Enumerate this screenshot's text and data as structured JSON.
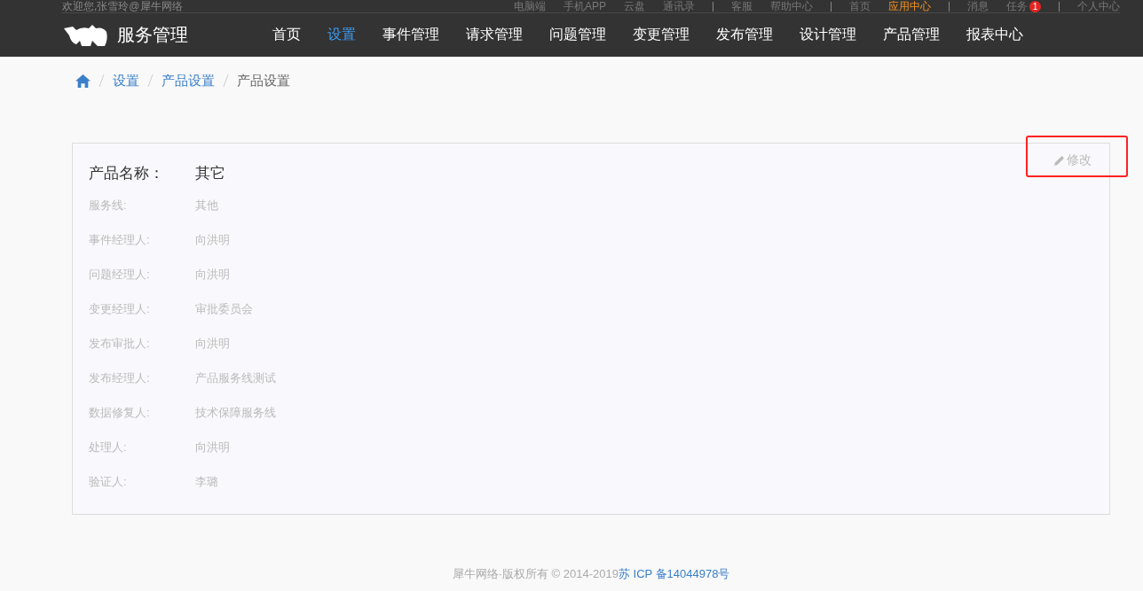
{
  "top_bar": {
    "welcome": "欢迎您,张雪玲@犀牛网络",
    "link_groups": [
      [
        {
          "label": "电脑端",
          "selected": false
        },
        {
          "label": "手机APP",
          "selected": false
        },
        {
          "label": "云盘",
          "selected": false
        },
        {
          "label": "通讯录",
          "selected": false
        }
      ],
      [
        {
          "label": "客服",
          "selected": false
        },
        {
          "label": "帮助中心",
          "selected": false
        }
      ],
      [
        {
          "label": "首页",
          "selected": false
        },
        {
          "label": "应用中心",
          "selected": true
        }
      ],
      [
        {
          "label": "消息",
          "selected": false
        },
        {
          "label": "任务",
          "selected": false,
          "badge": "1"
        }
      ],
      [
        {
          "label": "个人中心",
          "selected": false
        }
      ]
    ]
  },
  "header": {
    "app_name": "服务管理",
    "nav": [
      {
        "label": "首页",
        "selected": false
      },
      {
        "label": "设置",
        "selected": true
      },
      {
        "label": "事件管理",
        "selected": false
      },
      {
        "label": "请求管理",
        "selected": false
      },
      {
        "label": "问题管理",
        "selected": false
      },
      {
        "label": "变更管理",
        "selected": false
      },
      {
        "label": "发布管理",
        "selected": false
      },
      {
        "label": "设计管理",
        "selected": false
      },
      {
        "label": "产品管理",
        "selected": false
      },
      {
        "label": "报表中心",
        "selected": false
      }
    ]
  },
  "breadcrumb": [
    {
      "label": "设置",
      "link": true
    },
    {
      "label": "产品设置",
      "link": true
    },
    {
      "label": "产品设置",
      "link": false
    }
  ],
  "card": {
    "edit_button": {
      "label": "修改",
      "highlighted": true
    },
    "title": {
      "label": "产品名称：",
      "value": "其它"
    },
    "fields": [
      {
        "label": "服务线:",
        "value": "其他"
      },
      {
        "label": "事件经理人:",
        "value": "向洪明"
      },
      {
        "label": "问题经理人:",
        "value": "向洪明"
      },
      {
        "label": "变更经理人:",
        "value": "审批委员会"
      },
      {
        "label": "发布审批人:",
        "value": "向洪明"
      },
      {
        "label": "发布经理人:",
        "value": "产品服务线测试"
      },
      {
        "label": "数据修复人:",
        "value": "技术保障服务线"
      },
      {
        "label": "处理人:",
        "value": "向洪明"
      },
      {
        "label": "验证人:",
        "value": "李璐"
      }
    ]
  },
  "footer": {
    "copyright": "犀牛网络·版权所有 © 2014-2019",
    "icp": "苏 ICP 备14044978号"
  }
}
